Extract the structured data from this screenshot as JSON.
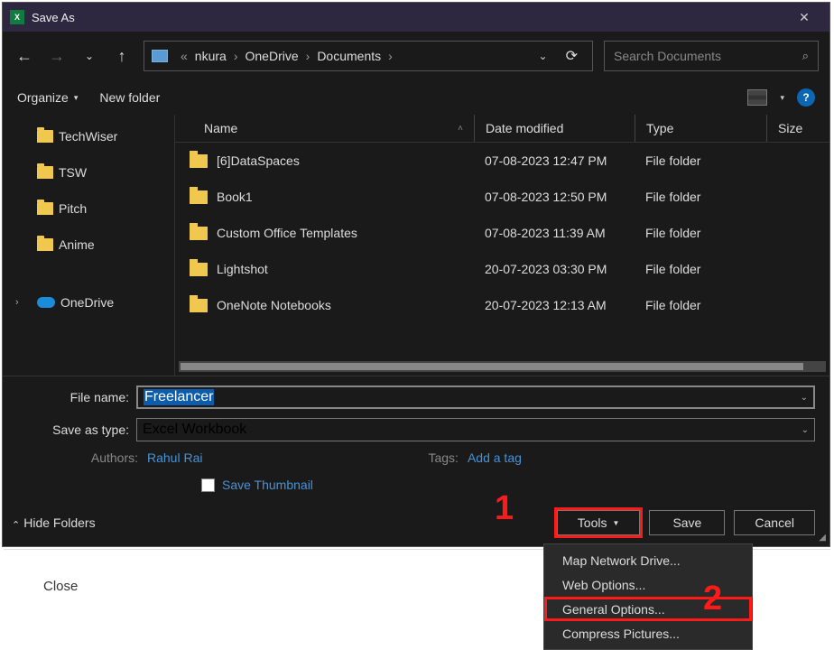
{
  "titlebar": {
    "title": "Save As"
  },
  "nav": {
    "breadcrumb_prefix": "«",
    "crumbs": [
      "nkura",
      "OneDrive",
      "Documents"
    ],
    "search_placeholder": "Search Documents"
  },
  "toolbar": {
    "organize": "Organize",
    "newfolder": "New folder"
  },
  "sidebar": {
    "items": [
      {
        "label": "TechWiser"
      },
      {
        "label": "TSW"
      },
      {
        "label": "Pitch"
      },
      {
        "label": "Anime"
      }
    ],
    "onedrive": "OneDrive"
  },
  "columns": {
    "name": "Name",
    "date": "Date modified",
    "type": "Type",
    "size": "Size"
  },
  "files": [
    {
      "name": "[6]DataSpaces",
      "date": "07-08-2023 12:47 PM",
      "type": "File folder"
    },
    {
      "name": "Book1",
      "date": "07-08-2023 12:50 PM",
      "type": "File folder"
    },
    {
      "name": "Custom Office Templates",
      "date": "07-08-2023 11:39 AM",
      "type": "File folder"
    },
    {
      "name": "Lightshot",
      "date": "20-07-2023 03:30 PM",
      "type": "File folder"
    },
    {
      "name": "OneNote Notebooks",
      "date": "20-07-2023 12:13 AM",
      "type": "File folder"
    }
  ],
  "form": {
    "filename_label": "File name:",
    "filename_value": "Freelancer",
    "savetype_label": "Save as type:",
    "savetype_value": "Excel Workbook",
    "authors_label": "Authors:",
    "authors_value": "Rahul Rai",
    "tags_label": "Tags:",
    "tags_value": "Add a tag",
    "thumbnail_label": "Save Thumbnail"
  },
  "footer": {
    "hide_folders": "Hide Folders",
    "tools": "Tools",
    "save": "Save",
    "cancel": "Cancel"
  },
  "dropdown": {
    "items": [
      "Map Network Drive...",
      "Web Options...",
      "General Options...",
      "Compress Pictures..."
    ]
  },
  "annotations": {
    "one": "1",
    "two": "2"
  },
  "background": {
    "close": "Close"
  }
}
